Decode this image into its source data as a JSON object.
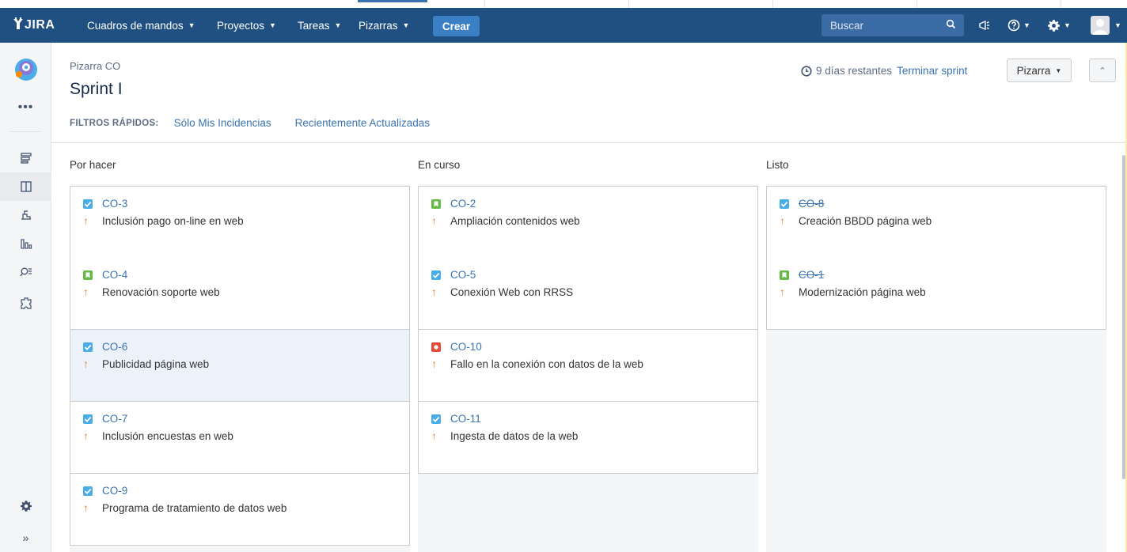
{
  "nav": {
    "logo": "JIRA",
    "menus": [
      {
        "label": "Cuadros de mandos"
      },
      {
        "label": "Proyectos"
      },
      {
        "label": "Tareas"
      },
      {
        "label": "Pizarras"
      }
    ],
    "create_label": "Crear",
    "search_placeholder": "Buscar",
    "icons": [
      "search-icon",
      "megaphone-icon",
      "help-icon",
      "gear-icon",
      "avatar-icon"
    ],
    "brand_color": "#205081",
    "create_color": "#3b7fc4"
  },
  "sidebar": {
    "icons": [
      "project-avatar-icon",
      "more-icon",
      "backlog-icon",
      "board-icon",
      "releases-icon",
      "reports-icon",
      "issues-icon",
      "components-icon",
      "settings-icon",
      "expand-icon"
    ],
    "active": "board-icon"
  },
  "header": {
    "breadcrumb": "Pizarra CO",
    "title": "Sprint I",
    "remaining": "9 días restantes",
    "complete_sprint": "Terminar sprint",
    "board_button": "Pizarra",
    "filters_label": "FILTROS RÁPIDOS:",
    "filters": [
      "Sólo Mis Incidencias",
      "Recientemente Actualizadas"
    ]
  },
  "board": {
    "columns": [
      {
        "title": "Por hacer",
        "cards": [
          {
            "key": "CO-3",
            "type": "task",
            "summary": "Inclusión pago on-line en web",
            "done": false
          },
          {
            "key": "CO-4",
            "type": "story",
            "summary": "Renovación soporte web",
            "done": false
          },
          {
            "key": "CO-6",
            "type": "task",
            "summary": "Publicidad página web",
            "done": false,
            "selected": true
          },
          {
            "key": "CO-7",
            "type": "task",
            "summary": "Inclusión encuestas en web",
            "done": false
          },
          {
            "key": "CO-9",
            "type": "task",
            "summary": "Programa de tratamiento de datos web",
            "done": false
          }
        ]
      },
      {
        "title": "En curso",
        "cards": [
          {
            "key": "CO-2",
            "type": "story",
            "summary": "Ampliación contenidos web",
            "done": false
          },
          {
            "key": "CO-5",
            "type": "task",
            "summary": "Conexión Web con RRSS",
            "done": false
          },
          {
            "key": "CO-10",
            "type": "bug",
            "summary": "Fallo en la conexión con datos de la web",
            "done": false
          },
          {
            "key": "CO-11",
            "type": "task",
            "summary": "Ingesta de datos de la web",
            "done": false
          }
        ]
      },
      {
        "title": "Listo",
        "cards": [
          {
            "key": "CO-8",
            "type": "task",
            "summary": "Creación BBDD página web",
            "done": true
          },
          {
            "key": "CO-1",
            "type": "story",
            "summary": "Modernización página web",
            "done": true
          }
        ]
      }
    ],
    "priority_icon": "arrow-up-icon",
    "priority_color": "#e97f33"
  }
}
